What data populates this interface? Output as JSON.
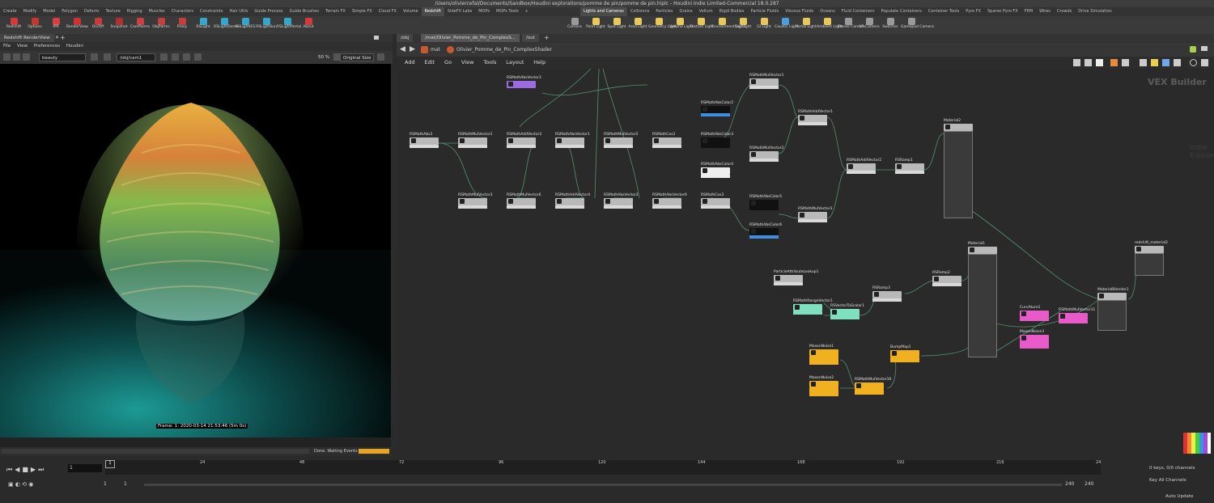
{
  "window_title": "/Users/oliviercefal/Documents/Sandbox/Houdini explorations/pomme de pin/pomme de pin.hiplc - Houdini Indie Limited-Commercial 18.0.287",
  "shelf_tabs_left": [
    "Create",
    "Modify",
    "Model",
    "Polygon",
    "Deform",
    "Texture",
    "Rigging",
    "Muscles",
    "Characters",
    "Constraints",
    "Hair Utils",
    "Guide Process",
    "Guide Brushes",
    "Terrain FX",
    "Simple FX",
    "Cloud FX",
    "Volume",
    "Redshift",
    "SideFX Labs",
    "MOPs",
    "MOPs Tools",
    "+"
  ],
  "shelf_tabs_right": [
    "Lights and Cameras",
    "Collisions",
    "Particles",
    "Grains",
    "Vellum",
    "Rigid Bodies",
    "Particle Fluids",
    "Viscous Fluids",
    "Oceans",
    "Fluid Containers",
    "Populate Containers",
    "Container Tools",
    "Pyro FX",
    "Sparse Pyro FX",
    "FEM",
    "Wires",
    "Crowds",
    "Drive Simulation"
  ],
  "tools_left": [
    {
      "label": "Redshift",
      "color": "#d43a3a"
    },
    {
      "label": "Options",
      "color": "#c0392b"
    },
    {
      "label": "IPR",
      "color": "#d64040"
    },
    {
      "label": "RenderView",
      "color": "#cc3333"
    },
    {
      "label": "On/Off",
      "color": "#c83a3a"
    },
    {
      "label": "Snapshot",
      "color": "#b03030"
    },
    {
      "label": "CamParms",
      "color": "#c94040"
    },
    {
      "label": "ObjParms",
      "color": "#c43e3e"
    },
    {
      "label": "Proxy",
      "color": "#c43e3e"
    },
    {
      "label": "RSLight",
      "color": "#35a6c9"
    },
    {
      "label": "RSLightDome",
      "color": "#35a6c9"
    },
    {
      "label": "RSLightIES",
      "color": "#35a6c9"
    },
    {
      "label": "RSLightSun",
      "color": "#35a6c9"
    },
    {
      "label": "RSLightPortal",
      "color": "#35a6c9"
    },
    {
      "label": "About",
      "color": "#d43a3a"
    }
  ],
  "tools_right": [
    {
      "label": "Camera",
      "color": "#9a9a9a"
    },
    {
      "label": "Point Light",
      "color": "#e8c85a"
    },
    {
      "label": "Spot Light",
      "color": "#e8c85a"
    },
    {
      "label": "Area Light",
      "color": "#e8c85a"
    },
    {
      "label": "Geometry Light",
      "color": "#e8c85a"
    },
    {
      "label": "Volume Light",
      "color": "#e8c85a"
    },
    {
      "label": "Distant Light",
      "color": "#e8c85a"
    },
    {
      "label": "Environment Light",
      "color": "#e8c85a"
    },
    {
      "label": "Sky Light",
      "color": "#e8c85a"
    },
    {
      "label": "GI Light",
      "color": "#e8c85a"
    },
    {
      "label": "Caustic Light",
      "color": "#4a9fe0"
    },
    {
      "label": "Portal Light",
      "color": "#e8c85a"
    },
    {
      "label": "Ambient Light",
      "color": "#e8c85a"
    },
    {
      "label": "Stereo Camera",
      "color": "#9a9a9a"
    },
    {
      "label": "VR Camera",
      "color": "#9a9a9a"
    },
    {
      "label": "Switcher",
      "color": "#9a9a9a"
    },
    {
      "label": "Gamepad Camera",
      "color": "#9a9a9a"
    }
  ],
  "left_panel": {
    "tab": "Redshift RenderView",
    "menu": [
      "File",
      "View",
      "Preferences",
      "Houdini"
    ],
    "aov": "beauty",
    "camera": "/obj/cam1",
    "zoom": "50 %",
    "size_mode": "Original Size",
    "frame_info": "Frame: 1: 2020-03-14 21:53:46  (5m 0s)",
    "status": "Done. Waiting Events"
  },
  "right_panel": {
    "path_tabs": [
      "/obj",
      "/mat/Olivier_Pomme_de_Pin_ComplexS...",
      "/out",
      "+"
    ],
    "context": "mat",
    "node_path": "Olivier_Pomme_de_Pin_ComplexShader",
    "menu": [
      "Add",
      "Edit",
      "Go",
      "View",
      "Tools",
      "Layout",
      "Help"
    ],
    "watermark": "Indie Edition",
    "network_type": "VEX Builder"
  },
  "nodes": [
    {
      "name": "RSMathAbsVector3",
      "color": "#9a6ce0"
    },
    {
      "name": "RSMathAbs3",
      "color": "#b9b9b9"
    },
    {
      "name": "RSMathMulVector1",
      "color": "#b9b9b9"
    },
    {
      "name": "RSMathAddVector3",
      "color": "#b9b9b9"
    },
    {
      "name": "RSMathAbsVector1",
      "color": "#b9b9b9"
    },
    {
      "name": "RSMathMulVector5",
      "color": "#b9b9b9"
    },
    {
      "name": "RSMathCos2",
      "color": "#b9b9b9"
    },
    {
      "name": "RSMathAbsColor2",
      "color": "#3d8ee0"
    },
    {
      "name": "RSMathAbsColor3",
      "color": "#111111"
    },
    {
      "name": "RSMathAbsColor4",
      "color": "#e8e8e8"
    },
    {
      "name": "RSMathMulVector1",
      "color": "#b9b9b9"
    },
    {
      "name": "RSMathMulVector2",
      "color": "#b9b9b9"
    },
    {
      "name": "RSMathAddVector1",
      "color": "#b9b9b9"
    },
    {
      "name": "RSMathAddVector2",
      "color": "#b9b9b9"
    },
    {
      "name": "RSRamp1",
      "color": "#b9b9b9"
    },
    {
      "name": "Material2",
      "color": "#b9b9b9"
    },
    {
      "name": "RSMathMulVector3",
      "color": "#b9b9b9"
    },
    {
      "name": "RSMathMulVector6",
      "color": "#b9b9b9"
    },
    {
      "name": "RSMathAddVector4",
      "color": "#b9b9b9"
    },
    {
      "name": "RSMathAbsVector2",
      "color": "#b9b9b9"
    },
    {
      "name": "RSMathAbsVector6",
      "color": "#b9b9b9"
    },
    {
      "name": "RSMathCos3",
      "color": "#b9b9b9"
    },
    {
      "name": "RSMathAbsColor5",
      "color": "#111111"
    },
    {
      "name": "RSMathAbsColor6",
      "color": "#3d8ee0"
    },
    {
      "name": "RSMathMulVector3",
      "color": "#b9b9b9"
    },
    {
      "name": "ParticleAttributeLookup1",
      "color": "#b9b9b9"
    },
    {
      "name": "RSMathRangeVector1",
      "color": "#7fe0c0"
    },
    {
      "name": "RSVectorToScalar1",
      "color": "#7fe0c0"
    },
    {
      "name": "RSRamp3",
      "color": "#b9b9b9"
    },
    {
      "name": "RSRamp2",
      "color": "#b9b9b9"
    },
    {
      "name": "Material1",
      "color": "#b9b9b9"
    },
    {
      "name": "MaxonNoise1",
      "color": "#f0b020"
    },
    {
      "name": "MaxonNoise2",
      "color": "#f0b020"
    },
    {
      "name": "RSMathMulVector10",
      "color": "#f0b020"
    },
    {
      "name": "BumpMap1",
      "color": "#f0b020"
    },
    {
      "name": "CurvAture1",
      "color": "#e85ac8"
    },
    {
      "name": "MaxonNoise3",
      "color": "#e85ac8"
    },
    {
      "name": "RSMathMulVector11",
      "color": "#e85ac8"
    },
    {
      "name": "MaterialBlender1",
      "color": "#b9b9b9"
    },
    {
      "name": "redshift_material2",
      "color": "#b9b9b9"
    }
  ],
  "timeline": {
    "current_frame": "1",
    "ticks": [
      "1",
      "24",
      "48",
      "72",
      "96",
      "120",
      "144",
      "168",
      "192",
      "216",
      "24"
    ],
    "start_frame": "1",
    "range_start": "1",
    "range_end": "240",
    "end_frame": "240",
    "keys_info": "0 keys, 0/0 channels",
    "key_all": "Key All Channels",
    "auto_update": "Auto Update"
  }
}
